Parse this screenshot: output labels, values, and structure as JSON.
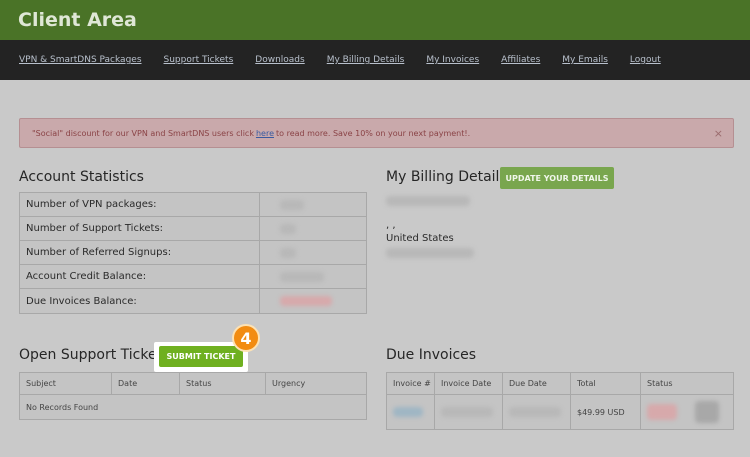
{
  "header": {
    "title": "Client Area"
  },
  "nav": {
    "items": [
      "VPN & SmartDNS Packages",
      "Support Tickets",
      "Downloads",
      "My Billing Details",
      "My Invoices",
      "Affiliates",
      "My Emails",
      "Logout"
    ]
  },
  "alert": {
    "text_before": "\"Social\" discount for our VPN and SmartDNS users click",
    "link": "here",
    "text_after": "to read more. Save 10% on your next payment!.",
    "close": "×"
  },
  "account": {
    "title": "Account Statistics",
    "rows": [
      "Number of VPN packages:",
      "Number of Support Tickets:",
      "Number of Referred Signups:",
      "Account Credit Balance:",
      "Due Invoices Balance:"
    ]
  },
  "billing": {
    "title": "My Billing Details",
    "update_button": "UPDATE YOUR DETAILS",
    "separator": ", ,",
    "country": "United States"
  },
  "tickets": {
    "title": "Open Support Tickets",
    "submit_button": "SUBMIT TICKET",
    "step_badge": "4",
    "columns": [
      "Subject",
      "Date",
      "Status",
      "Urgency"
    ],
    "empty": "No Records Found"
  },
  "invoices": {
    "title": "Due Invoices",
    "columns": [
      "Invoice #",
      "Invoice Date",
      "Due Date",
      "Total",
      "Status"
    ],
    "total": "$49.99 USD"
  },
  "colors": {
    "header": "#4a7327",
    "nav": "#232323",
    "accent_green": "#6fb020",
    "badge_orange": "#f28c12"
  }
}
